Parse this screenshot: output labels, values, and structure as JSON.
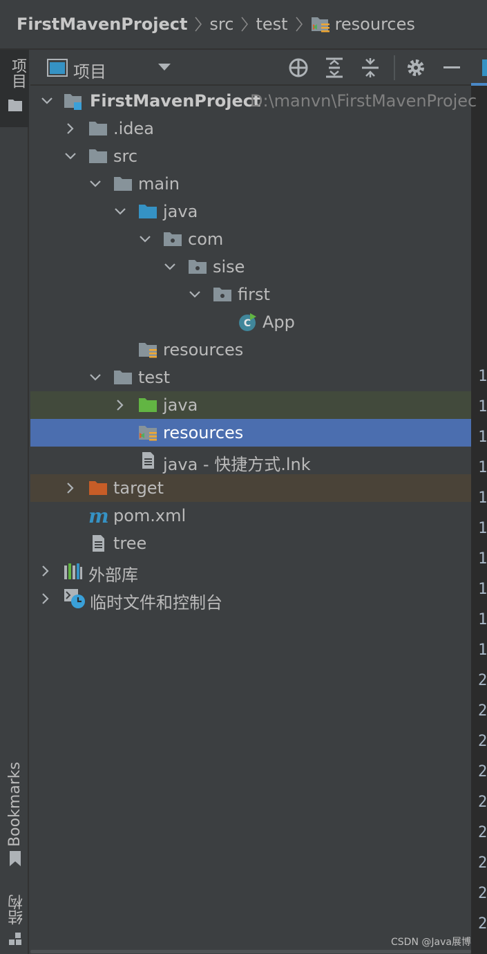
{
  "breadcrumb": {
    "items": [
      "FirstMavenProject",
      "src",
      "test",
      "resources"
    ]
  },
  "left_strip": {
    "project_tab": "项目",
    "bookmarks_tab": "Bookmarks",
    "structure_tab": "结构"
  },
  "panel_header": {
    "view_label": "项目",
    "icons": [
      "locate-icon",
      "expand-all-icon",
      "collapse-all-icon",
      "gear-icon",
      "minimize-icon"
    ]
  },
  "tree": {
    "rows": [
      {
        "label": "FirstMavenProject",
        "path": "D:\\manvn\\FirstMavenProjec"
      },
      {
        "label": ".idea"
      },
      {
        "label": "src"
      },
      {
        "label": "main"
      },
      {
        "label": "java"
      },
      {
        "label": "com"
      },
      {
        "label": "sise"
      },
      {
        "label": "first"
      },
      {
        "label": "App"
      },
      {
        "label": "resources"
      },
      {
        "label": "test"
      },
      {
        "label": "java"
      },
      {
        "label": "resources"
      },
      {
        "label": "java - 快捷方式.lnk"
      },
      {
        "label": "target"
      },
      {
        "label": "pom.xml"
      },
      {
        "label": "tree"
      },
      {
        "label": "外部库"
      },
      {
        "label": "临时文件和控制台"
      }
    ]
  },
  "gutter": {
    "numbers": [
      "1",
      "1",
      "1",
      "1",
      "1",
      "1",
      "1",
      "1",
      "1",
      "1",
      "2",
      "2",
      "2",
      "2",
      "2",
      "2",
      "2",
      "2",
      "2"
    ]
  },
  "colors": {
    "background": "#3c3f41",
    "selection": "#4b6eaf",
    "test_highlight": "#424a3c",
    "target_highlight": "#4a4338",
    "folder_gray": "#87939a",
    "folder_blue": "#3592c4",
    "folder_green": "#62b543",
    "folder_orange": "#c75d27"
  },
  "watermark": "CSDN @Java展博"
}
